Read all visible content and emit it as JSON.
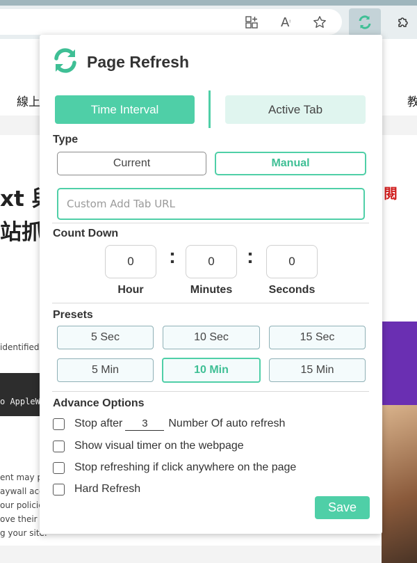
{
  "browser": {
    "background_text": {
      "left_title_a": "xt 與",
      "left_title_b": "站抓",
      "nav_left": "線上",
      "nav_right": "教",
      "red_char": "閱",
      "snippet_1": "identified",
      "snippet_2": "o AppleW",
      "snippet_3": "ent may p",
      "snippet_4": "aywall acc",
      "snippet_5": "our policie",
      "snippet_6": "ove their d",
      "snippet_7": "g your site."
    },
    "icons": [
      "apps-icon",
      "read-aloud-icon",
      "favorite-star-icon",
      "page-refresh-extension-icon",
      "extensions-puzzle-icon"
    ]
  },
  "popup": {
    "title": "Page Refresh",
    "tabs": {
      "time_interval": "Time Interval",
      "active_tab": "Active Tab"
    },
    "type": {
      "label": "Type",
      "current": "Current",
      "manual": "Manual",
      "selected": "Manual"
    },
    "url_input": {
      "placeholder": "Custom Add Tab URL",
      "value": ""
    },
    "countdown": {
      "label": "Count Down",
      "hour_value": "0",
      "minutes_value": "0",
      "seconds_value": "0",
      "hour_label": "Hour",
      "minutes_label": "Minutes",
      "seconds_label": "Seconds",
      "separator": ":"
    },
    "presets": {
      "label": "Presets",
      "items": [
        "5 Sec",
        "10 Sec",
        "15 Sec",
        "5 Min",
        "10 Min",
        "15 Min"
      ],
      "selected": "10 Min"
    },
    "advance": {
      "label": "Advance Options",
      "stop_after_prefix": "Stop after",
      "stop_after_value": "3",
      "stop_after_suffix": "Number Of auto refresh",
      "visual_timer": "Show visual timer on the webpage",
      "stop_on_click": "Stop refreshing if click anywhere on the page",
      "hard_refresh": "Hard Refresh"
    },
    "save_label": "Save"
  },
  "colors": {
    "accent": "#4fcfa7",
    "accent_light": "#e0f5ef",
    "preset_border": "#8fb0b6",
    "text": "#333333"
  }
}
